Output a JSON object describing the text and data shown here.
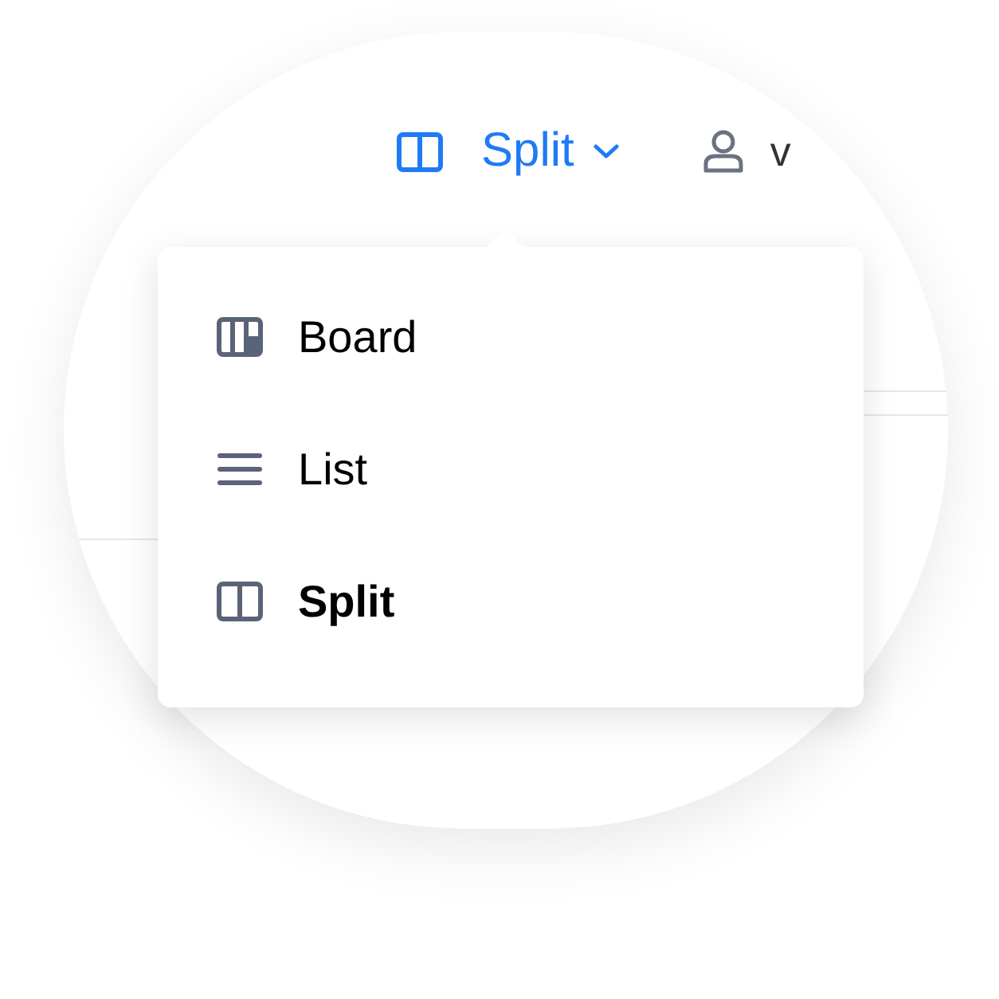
{
  "view_switcher": {
    "label": "Split",
    "kind": "split",
    "expanded": true
  },
  "user_menu": {
    "text": "v"
  },
  "view_menu": {
    "items": [
      {
        "label": "Board",
        "kind": "board",
        "selected": false
      },
      {
        "label": "List",
        "kind": "list",
        "selected": false
      },
      {
        "label": "Split",
        "kind": "split",
        "selected": true
      }
    ]
  }
}
